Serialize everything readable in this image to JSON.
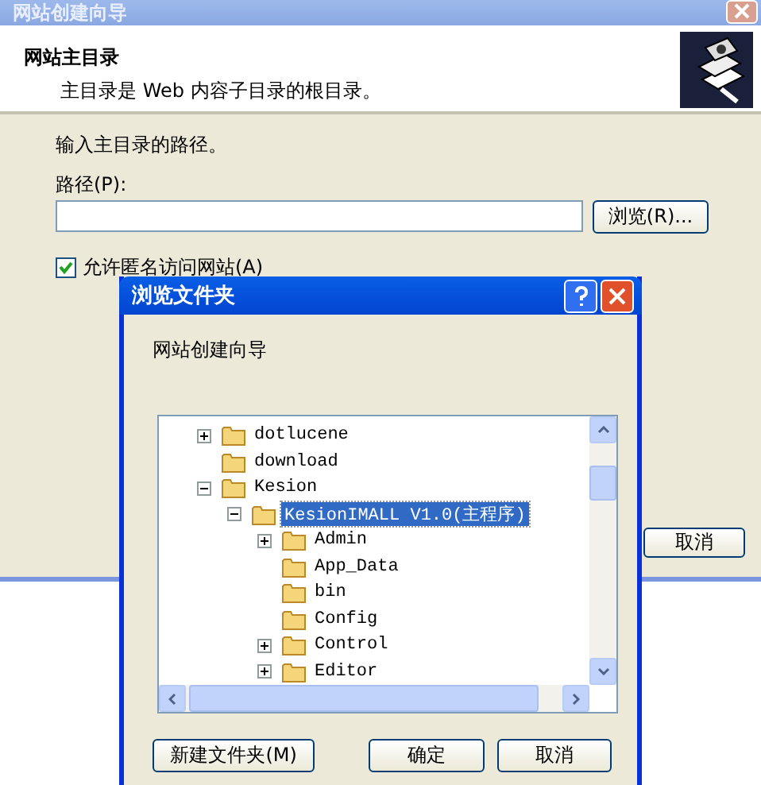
{
  "wizard": {
    "title": "网站创建向导",
    "header": {
      "title": "网站主目录",
      "subtitle": "主目录是 Web 内容子目录的根目录。"
    },
    "prompt": "输入主目录的路径。",
    "path_label": "路径(P):",
    "browse_button": "浏览(R)...",
    "anonymous": {
      "label": "允许匿名访问网站(A)",
      "checked": true
    },
    "buttons": [
      "取消"
    ]
  },
  "dialog": {
    "title": "浏览文件夹",
    "description": "网站创建向导",
    "tree": [
      {
        "label": "dotlucene",
        "kind": "branch",
        "expanded": false,
        "selected": false
      },
      {
        "label": "download",
        "kind": "leaf",
        "selected": false
      },
      {
        "label": "Kesion",
        "kind": "branch",
        "expanded": true,
        "selected": false,
        "children": [
          {
            "label": "KesionIMALL V1.0(主程序)",
            "kind": "branch",
            "expanded": true,
            "selected": true,
            "children": [
              {
                "label": "Admin",
                "kind": "branch",
                "expanded": false,
                "selected": false
              },
              {
                "label": "App_Data",
                "kind": "leaf",
                "selected": false
              },
              {
                "label": "bin",
                "kind": "leaf",
                "selected": false
              },
              {
                "label": "Config",
                "kind": "leaf",
                "selected": false
              },
              {
                "label": "Control",
                "kind": "branch",
                "expanded": false,
                "selected": false
              },
              {
                "label": "Editor",
                "kind": "branch",
                "expanded": false,
                "selected": false
              }
            ]
          }
        ]
      }
    ],
    "buttons": [
      "新建文件夹(M)",
      "确定",
      "取消"
    ]
  }
}
